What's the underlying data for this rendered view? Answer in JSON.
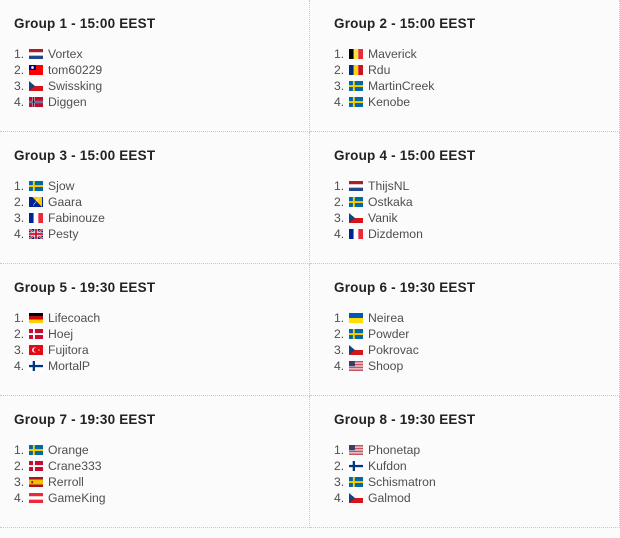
{
  "page": {
    "background_color": "#fbfbfb",
    "title_color": "#222222",
    "text_color": "#4f4f4f",
    "divider_color": "#c9c9c9"
  },
  "groups": [
    {
      "title": "Group 1 - 15:00 EEST",
      "name": "Group 1",
      "time": "15:00 EEST",
      "players": [
        {
          "rank": "1.",
          "name": "Vortex",
          "country": "Netherlands",
          "flag": "flag-nl"
        },
        {
          "rank": "2.",
          "name": "tom60229",
          "country": "Taiwan",
          "flag": "flag-tw"
        },
        {
          "rank": "3.",
          "name": "Swissking",
          "country": "Czech Republic",
          "flag": "flag-cz"
        },
        {
          "rank": "4.",
          "name": "Diggen",
          "country": "Norway",
          "flag": "flag-no"
        }
      ]
    },
    {
      "title": "Group 2 - 15:00 EEST",
      "name": "Group 2",
      "time": "15:00 EEST",
      "players": [
        {
          "rank": "1.",
          "name": "Maverick",
          "country": "Belgium",
          "flag": "flag-be"
        },
        {
          "rank": "2.",
          "name": "Rdu",
          "country": "Romania",
          "flag": "flag-ro"
        },
        {
          "rank": "3.",
          "name": "MartinCreek",
          "country": "Sweden",
          "flag": "flag-se"
        },
        {
          "rank": "4.",
          "name": "Kenobe",
          "country": "Sweden",
          "flag": "flag-se"
        }
      ]
    },
    {
      "title": "Group 3 - 15:00 EEST",
      "name": "Group 3",
      "time": "15:00 EEST",
      "players": [
        {
          "rank": "1.",
          "name": "Sjow",
          "country": "Sweden",
          "flag": "flag-se"
        },
        {
          "rank": "2.",
          "name": "Gaara",
          "country": "Bosnia and Herzegovina",
          "flag": "flag-ba"
        },
        {
          "rank": "3.",
          "name": "Fabinouze",
          "country": "France",
          "flag": "flag-fr"
        },
        {
          "rank": "4.",
          "name": "Pesty",
          "country": "United Kingdom",
          "flag": "flag-gb"
        }
      ]
    },
    {
      "title": "Group 4 - 15:00 EEST",
      "name": "Group 4",
      "time": "15:00 EEST",
      "players": [
        {
          "rank": "1.",
          "name": "ThijsNL",
          "country": "Netherlands",
          "flag": "flag-nl"
        },
        {
          "rank": "2.",
          "name": "Ostkaka",
          "country": "Sweden",
          "flag": "flag-se"
        },
        {
          "rank": "3.",
          "name": "Vanik",
          "country": "Czech Republic",
          "flag": "flag-cz"
        },
        {
          "rank": "4.",
          "name": "Dizdemon",
          "country": "France",
          "flag": "flag-fr"
        }
      ]
    },
    {
      "title": "Group 5 - 19:30 EEST",
      "name": "Group 5",
      "time": "19:30 EEST",
      "players": [
        {
          "rank": "1.",
          "name": "Lifecoach",
          "country": "Germany",
          "flag": "flag-de"
        },
        {
          "rank": "2.",
          "name": "Hoej",
          "country": "Denmark",
          "flag": "flag-dk"
        },
        {
          "rank": "3.",
          "name": "Fujitora",
          "country": "Turkey",
          "flag": "flag-tr"
        },
        {
          "rank": "4.",
          "name": "MortalP",
          "country": "Finland",
          "flag": "flag-fi"
        }
      ]
    },
    {
      "title": "Group 6 - 19:30 EEST",
      "name": "Group 6",
      "time": "19:30 EEST",
      "players": [
        {
          "rank": "1.",
          "name": "Neirea",
          "country": "Ukraine",
          "flag": "flag-ua"
        },
        {
          "rank": "2.",
          "name": "Powder",
          "country": "Sweden",
          "flag": "flag-se"
        },
        {
          "rank": "3.",
          "name": "Pokrovac",
          "country": "Czech Republic",
          "flag": "flag-cz"
        },
        {
          "rank": "4.",
          "name": "Shoop",
          "country": "United States",
          "flag": "flag-us"
        }
      ]
    },
    {
      "title": "Group 7 - 19:30 EEST",
      "name": "Group 7",
      "time": "19:30 EEST",
      "players": [
        {
          "rank": "1.",
          "name": "Orange",
          "country": "Sweden",
          "flag": "flag-se"
        },
        {
          "rank": "2.",
          "name": "Crane333",
          "country": "Denmark",
          "flag": "flag-dk"
        },
        {
          "rank": "3.",
          "name": "Rerroll",
          "country": "Spain",
          "flag": "flag-es"
        },
        {
          "rank": "4.",
          "name": "GameKing",
          "country": "Austria",
          "flag": "flag-at"
        }
      ]
    },
    {
      "title": "Group 8 - 19:30 EEST",
      "name": "Group 8",
      "time": "19:30 EEST",
      "players": [
        {
          "rank": "1.",
          "name": "Phonetap",
          "country": "United States",
          "flag": "flag-us"
        },
        {
          "rank": "2.",
          "name": "Kufdon",
          "country": "Finland",
          "flag": "flag-fi"
        },
        {
          "rank": "3.",
          "name": "Schismatron",
          "country": "Sweden",
          "flag": "flag-se"
        },
        {
          "rank": "4.",
          "name": "Galmod",
          "country": "Czech Republic",
          "flag": "flag-cz"
        }
      ]
    }
  ]
}
